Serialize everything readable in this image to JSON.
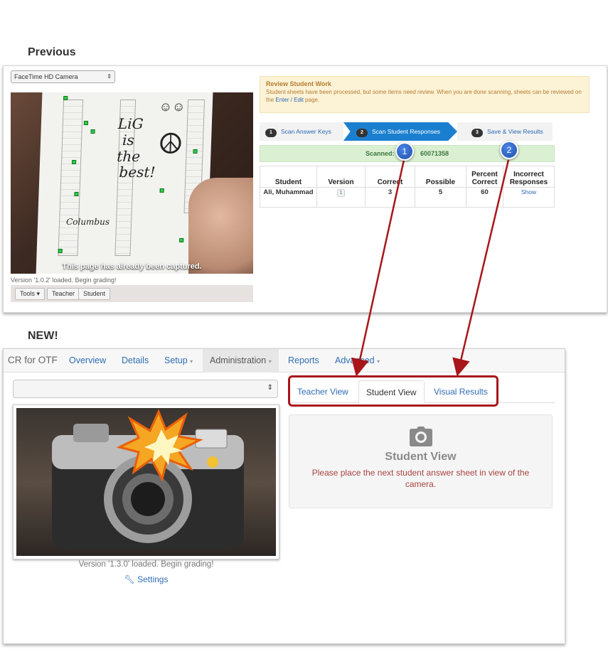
{
  "previous": {
    "heading": "Previous",
    "camera_select": "FaceTime HD Camera",
    "photo_caption": "This page has already been captured.",
    "handwriting": {
      "line1": "LiG",
      "line2": "is",
      "line3": "the",
      "line4": "best!",
      "signature": "Columbus"
    },
    "version_text": "Version '1.0.2' loaded. Begin grading!",
    "toolbar": {
      "tools": "Tools",
      "teacher": "Teacher",
      "student": "Student"
    },
    "review": {
      "title": "Review Student Work",
      "text_before": "Student sheets have been processed, but some items need review. When you are done scanning, sheets can be reviewed on the",
      "link": "Enter / Edit",
      "text_after": "page."
    },
    "steps": [
      {
        "num": "1",
        "label": "Scan Answer Keys"
      },
      {
        "num": "2",
        "label": "Scan Student Responses"
      },
      {
        "num": "3",
        "label": "Save & View Results"
      }
    ],
    "scanned_text": "Scanned: S",
    "scanned_suffix": "60071358",
    "table": {
      "headers": [
        "Student",
        "Version",
        "Correct",
        "Possible",
        "Percent Correct",
        "Incorrect Responses"
      ],
      "row": {
        "student": "Ali, Muhammad",
        "version": "1",
        "correct": "3",
        "possible": "5",
        "percent": "60",
        "incorrect": "Show"
      }
    }
  },
  "callouts": {
    "first": "1",
    "second": "2"
  },
  "new": {
    "heading": "NEW!",
    "nav": {
      "brand": "CR for OTF",
      "items": [
        "Overview",
        "Details",
        "Setup",
        "Administration",
        "Reports",
        "Advanced"
      ],
      "dropdown_caret": "▾"
    },
    "version_text": "Version '1.3.0' loaded. Begin grading!",
    "settings_link": "Settings",
    "tabs": [
      "Teacher View",
      "Student View",
      "Visual Results"
    ],
    "student_view": {
      "title": "Student View",
      "message": "Please place the next student answer sheet in view of the camera."
    }
  },
  "colors": {
    "link": "#2f6db3",
    "highlight": "#a8161b",
    "step_active": "#1b7fd0",
    "callout": "#2a5fc4"
  }
}
